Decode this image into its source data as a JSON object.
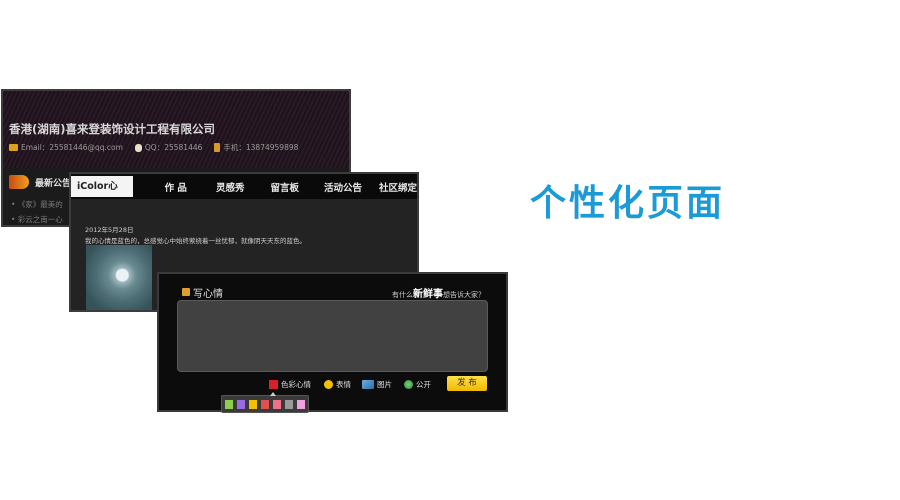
{
  "heading": "个性化页面",
  "card1": {
    "company": "香港(湖南)喜来登装饰设计工程有限公司",
    "email": "Email：25581446@qq.com",
    "qq": "QQ：25581446",
    "phone": "手机：13874959898",
    "notice_title": "最新公告",
    "notice_items": [
      "《家》最美的",
      "彩云之南一心"
    ]
  },
  "card2": {
    "tabs": [
      "iColor心情",
      "作 品",
      "灵感秀",
      "留言板",
      "活动公告",
      "社区绑定"
    ],
    "date": "2012年5月28日",
    "mood_text": "我的心情是蓝色的，总感觉心中始终萦绕着一丝忧郁，就像阴天天东的蓝色。"
  },
  "card3": {
    "title": "写心情",
    "prompt_prefix": "有什么",
    "prompt_bold": "新鲜事",
    "prompt_suffix": "想告诉大家？",
    "tools": [
      "色彩心情",
      "表情",
      "图片",
      "公开"
    ],
    "publish": "发 布"
  },
  "colors": {
    "accent": "#1a9ad6",
    "publish": "#f4c400",
    "palette": [
      "#8ccf4a",
      "#9a6ae0",
      "#f2c200",
      "#e05050",
      "#f07088",
      "#9a9a9a",
      "#f0a0e0"
    ]
  }
}
